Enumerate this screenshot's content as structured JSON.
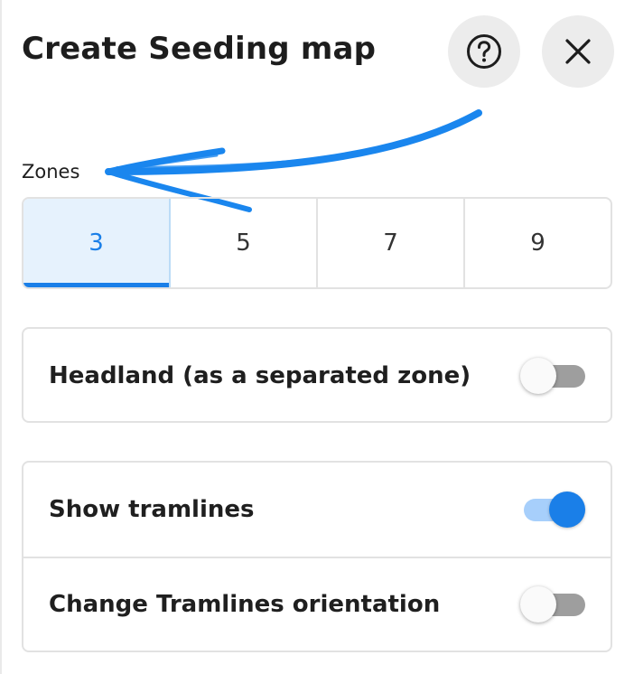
{
  "header": {
    "title": "Create Seeding map",
    "help_icon": "question-circle-icon",
    "close_icon": "close-icon"
  },
  "zones": {
    "label": "Zones",
    "options": [
      "3",
      "5",
      "7",
      "9"
    ],
    "selected": "3"
  },
  "settings": {
    "headland": {
      "label": "Headland (as a separated zone)",
      "enabled": false
    },
    "show_tramlines": {
      "label": "Show tramlines",
      "enabled": true
    },
    "change_orientation": {
      "label": "Change Tramlines orientation",
      "enabled": false
    }
  },
  "colors": {
    "accent": "#1a7fe8",
    "accent_light": "#e6f2fd",
    "annotation_arrow": "#1a86ee",
    "toggle_off_track": "#9e9e9e",
    "toggle_on_track": "#a7cffb"
  }
}
